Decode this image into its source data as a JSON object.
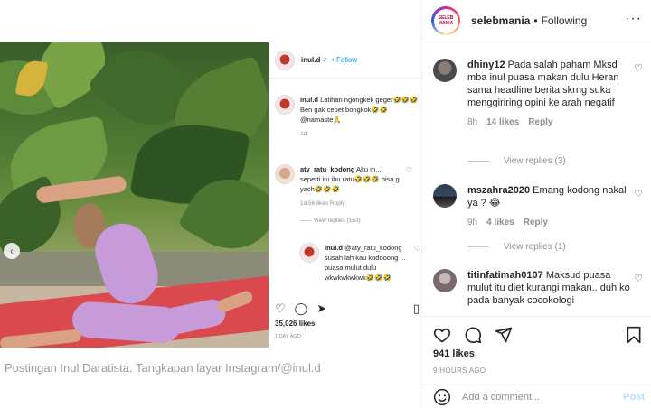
{
  "caption": "Postingan Inul Daratista. Tangkapan layar Instagram/@inul.d",
  "inner_post": {
    "username": "inul.d",
    "verified_mark": "✓",
    "follow_label": "Follow",
    "comments": [
      {
        "user": "inul.d",
        "text": "Latihan ngongkek geger🤣🤣🤣 Ben gak cepet bongkok🤣🤣 @namaste🙏",
        "meta": "1d"
      },
      {
        "user": "aty_ratu_kodong",
        "text": "Aku m... seperti itu ibu ratu🤣🤣🤣 bisa g yach🤣🤣🤣",
        "meta": "1d   56 likes   Reply",
        "replies": "View replies (163)"
      },
      {
        "user": "inul.d",
        "text": "@aty_ratu_kodong susah lah kau kodooong ... puasa mulut dulu wkwkwkwkwk🤣🤣🤣",
        "meta": ""
      }
    ],
    "likes": "35,026 likes",
    "time_ago": "1 DAY AGO"
  },
  "header": {
    "username": "selebmania",
    "separator": "•",
    "follow_status": "Following",
    "avatar_text": "SELEB MANIA"
  },
  "comments": [
    {
      "user": "dhiny12",
      "text": "Pada salah paham Mksd mba inul puasa makan dulu Heran sama headline berita skrng suka menggiriring opini ke arah negatif",
      "time": "8h",
      "likes": "14 likes",
      "reply": "Reply",
      "replies": "View replies (3)"
    },
    {
      "user": "mszahra2020",
      "text": "Emang kodong nakal ya ? 😂",
      "time": "9h",
      "likes": "4 likes",
      "reply": "Reply",
      "replies": "View replies (1)"
    },
    {
      "user": "titinfatimah0107",
      "text": "Maksud puasa mulut itu diet kurangi makan.. duh ko pada banyak cocokologi",
      "time": "",
      "likes": "",
      "reply": "",
      "replies": ""
    }
  ],
  "post": {
    "likes": "941 likes",
    "time": "9 HOURS AGO"
  },
  "add_comment": {
    "placeholder": "Add a comment...",
    "post_label": "Post"
  },
  "colors": {
    "link_blue": "#0095f6",
    "muted": "#8e8e8e",
    "post_disabled": "#b2dffc",
    "mat_red": "#d9494d",
    "outfit_purple": "#c79ad9"
  },
  "icons": [
    "heart-icon",
    "comment-icon",
    "share-icon",
    "bookmark-icon",
    "emoji-icon",
    "more-icon",
    "chevron-left-icon"
  ]
}
